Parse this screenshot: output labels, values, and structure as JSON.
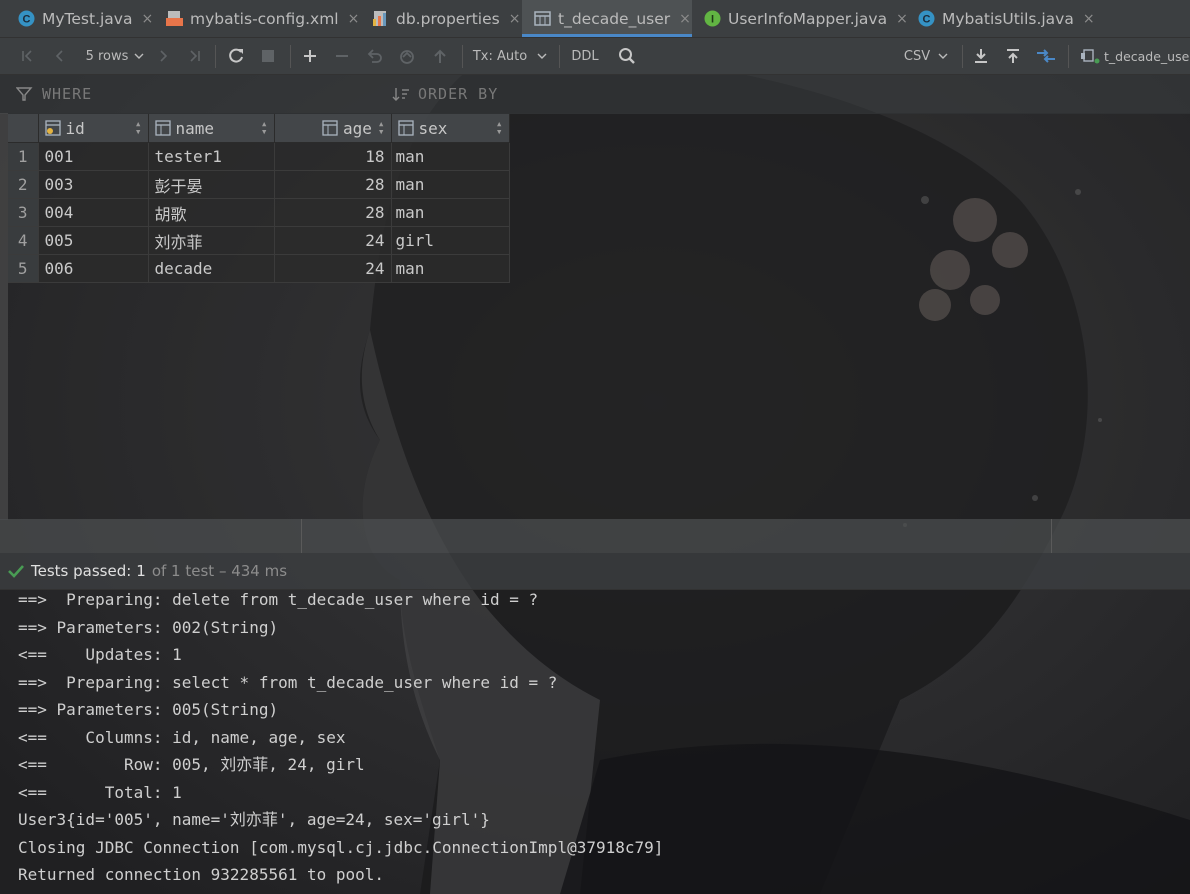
{
  "tabs": [
    {
      "label": "MyTest.java",
      "icon": "class-c-icon",
      "active": false
    },
    {
      "label": "mybatis-config.xml",
      "icon": "xml-file-icon",
      "active": false
    },
    {
      "label": "db.properties",
      "icon": "properties-file-icon",
      "active": false
    },
    {
      "label": "t_decade_user",
      "icon": "table-icon",
      "active": true
    },
    {
      "label": "UserInfoMapper.java",
      "icon": "interface-i-icon",
      "active": false
    },
    {
      "label": "MybatisUtils.java",
      "icon": "class-c-icon",
      "active": false
    }
  ],
  "tab_close_glyph": "×",
  "toolbar": {
    "rows_label": "5 rows",
    "tx_label": "Tx: Auto",
    "ddl_label": "DDL",
    "export_format": "CSV",
    "table_label": "t_decade_user"
  },
  "filter": {
    "where_label": "WHERE",
    "order_by_label": "ORDER BY"
  },
  "grid": {
    "columns": [
      "id",
      "name",
      "age",
      "sex"
    ],
    "rows": [
      {
        "n": "1",
        "id": "001",
        "name": "tester1",
        "age": "18",
        "sex": "man"
      },
      {
        "n": "2",
        "id": "003",
        "name": "彭于晏",
        "age": "28",
        "sex": "man"
      },
      {
        "n": "3",
        "id": "004",
        "name": "胡歌",
        "age": "28",
        "sex": "man"
      },
      {
        "n": "4",
        "id": "005",
        "name": "刘亦菲",
        "age": "24",
        "sex": "girl"
      },
      {
        "n": "5",
        "id": "006",
        "name": "decade",
        "age": "24",
        "sex": "man"
      }
    ]
  },
  "status": {
    "passed_label": "Tests passed:",
    "passed_count": "1",
    "detail": "of 1 test – 434 ms"
  },
  "console_lines": [
    "==>  Preparing: delete from t_decade_user where id = ?",
    "==> Parameters: 002(String)",
    "<==    Updates: 1",
    "==>  Preparing: select * from t_decade_user where id = ?",
    "==> Parameters: 005(String)",
    "<==    Columns: id, name, age, sex",
    "<==        Row: 005, 刘亦菲, 24, girl",
    "<==      Total: 1",
    "User3{id='005', name='刘亦菲', age=24, sex='girl'}",
    "Closing JDBC Connection [com.mysql.cj.jdbc.ConnectionImpl@37918c79]",
    "Returned connection 932285561 to pool."
  ],
  "colors": {
    "accent": "#4a88c7",
    "pass_green": "#499c54",
    "panel": "#3c3f41",
    "editor_bg": "#2b2b2b"
  }
}
